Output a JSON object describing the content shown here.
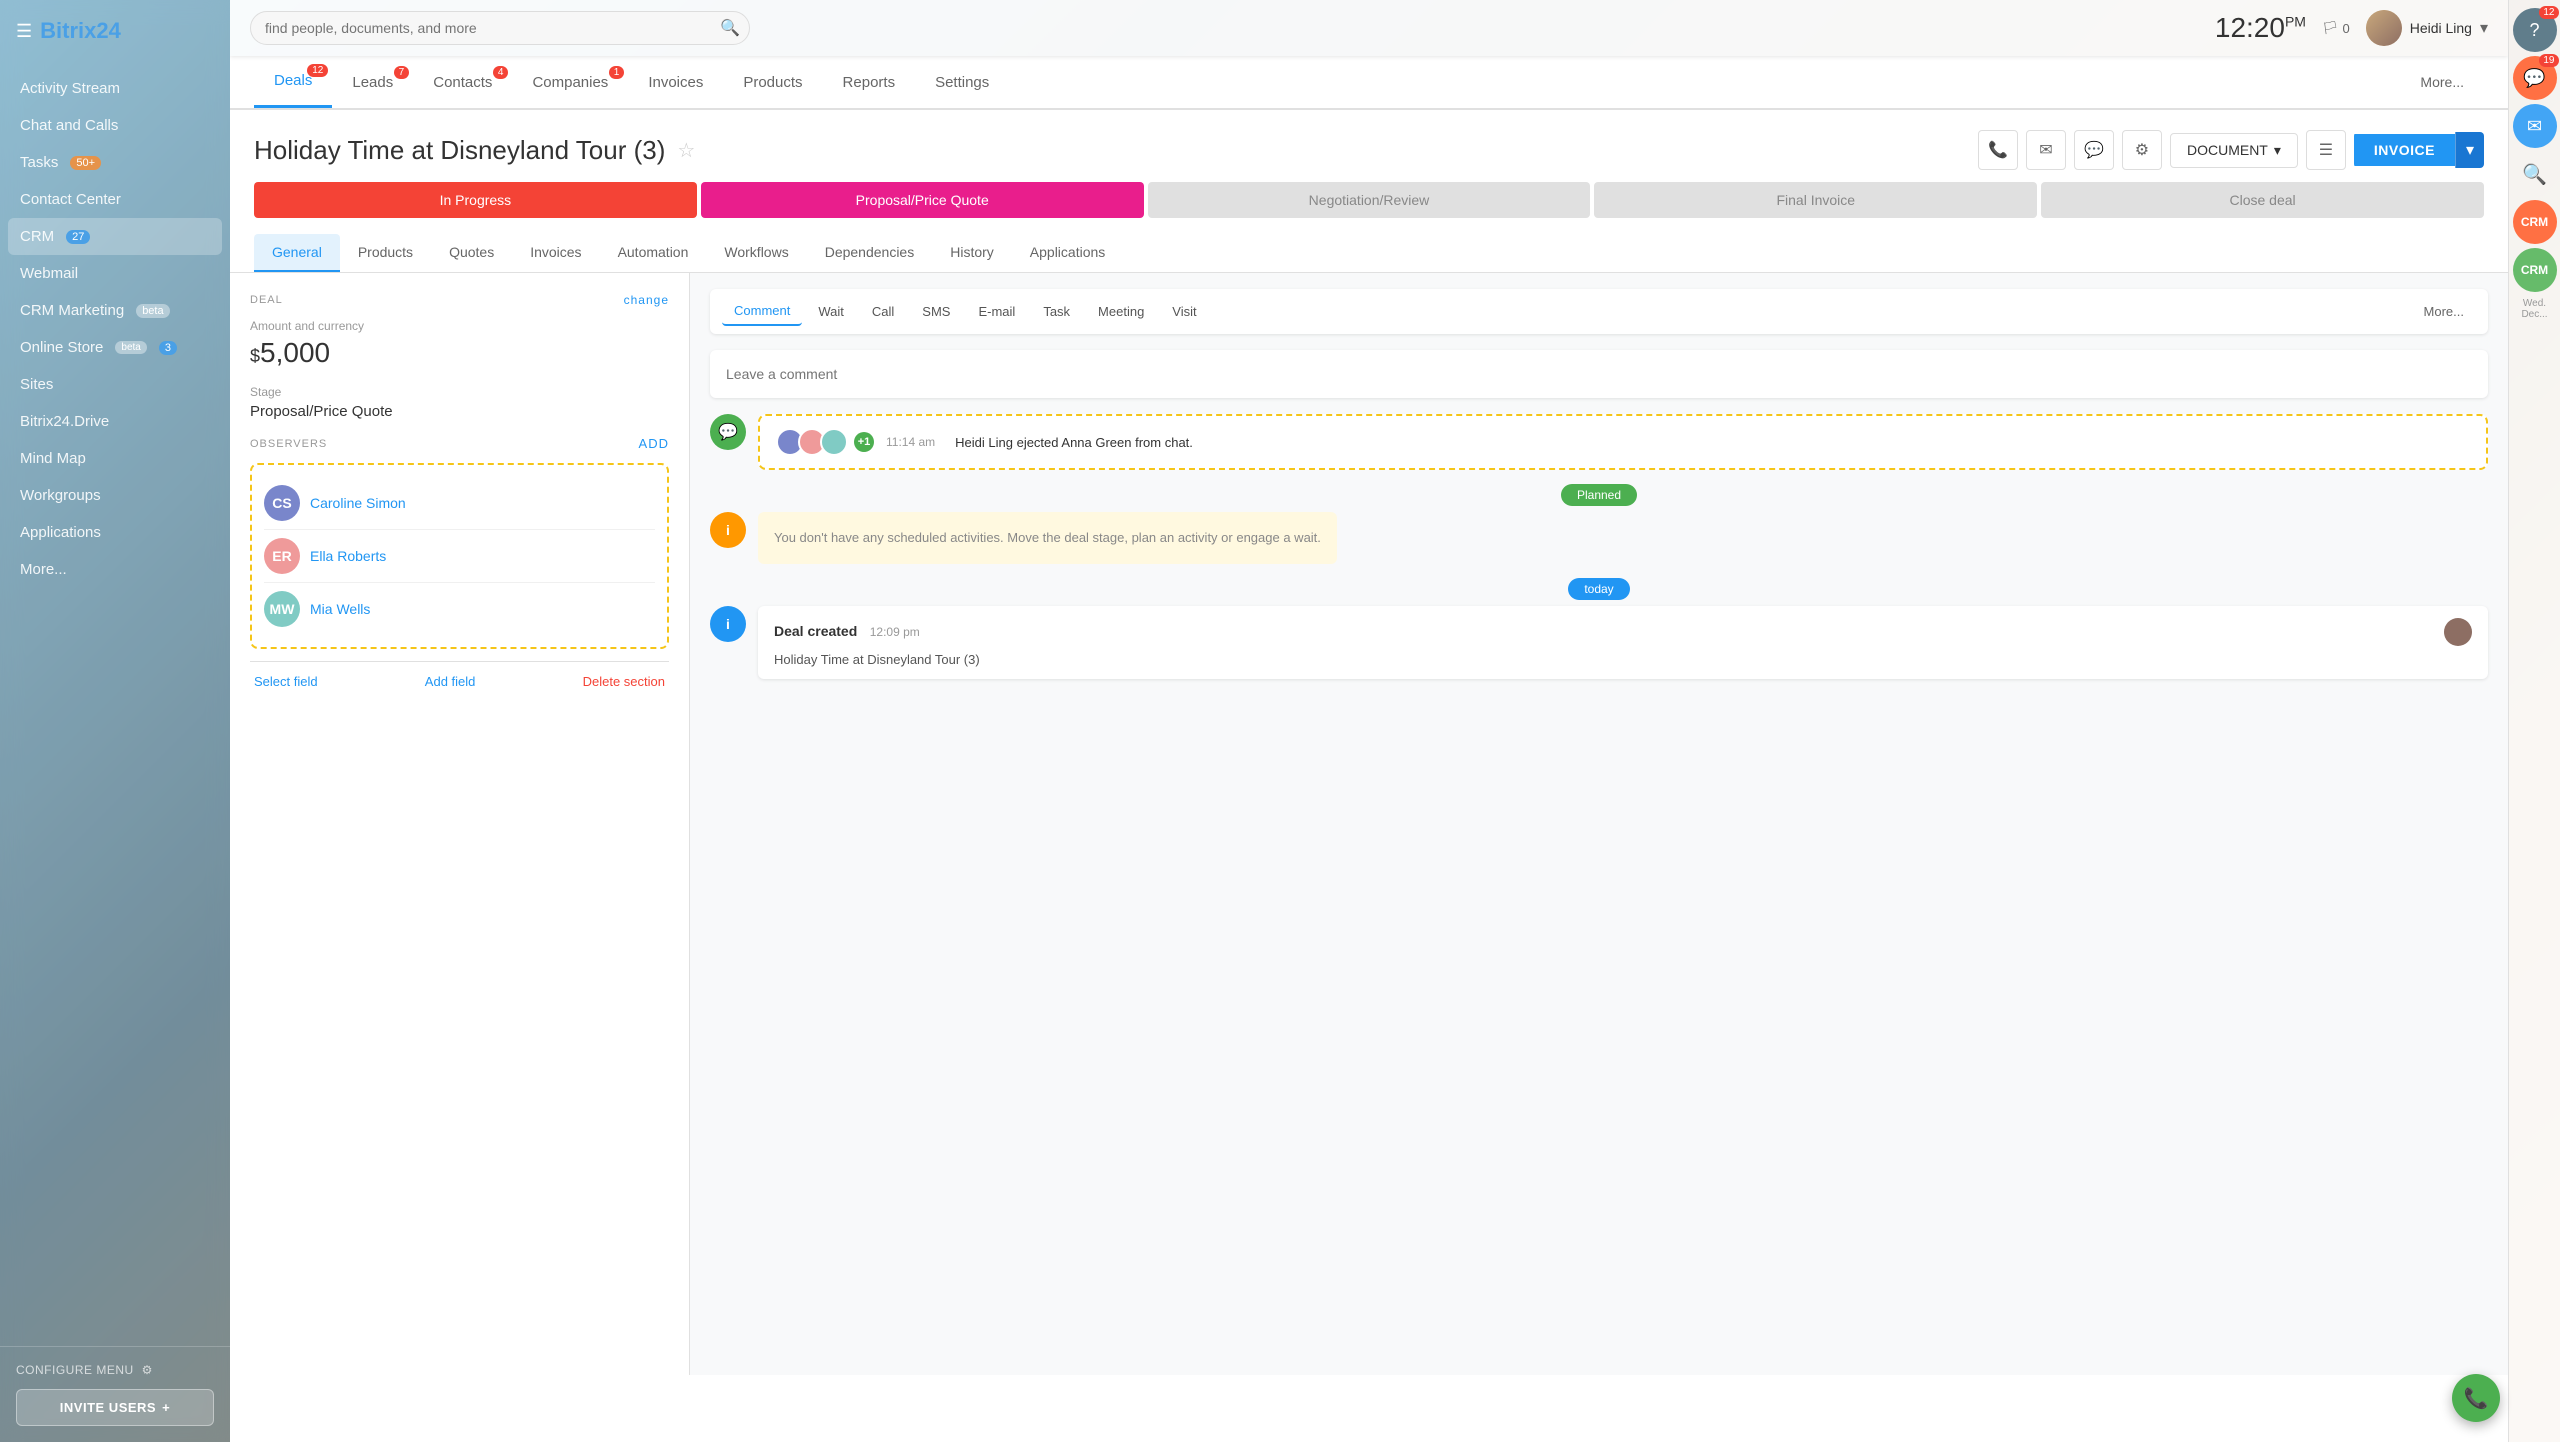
{
  "app": {
    "logo_text_main": "Bitrix",
    "logo_text_accent": "24"
  },
  "topbar": {
    "search_placeholder": "find people, documents, and more",
    "time": "12:20",
    "time_suffix": "PM",
    "flag_count": "0",
    "username": "Heidi Ling"
  },
  "sidebar": {
    "items": [
      {
        "label": "Activity Stream",
        "badge": null
      },
      {
        "label": "Chat and Calls",
        "badge": null
      },
      {
        "label": "Tasks",
        "badge": "50+",
        "badge_type": "orange"
      },
      {
        "label": "Contact Center",
        "badge": null
      },
      {
        "label": "CRM",
        "badge": "27",
        "active": true
      },
      {
        "label": "Webmail",
        "badge": null
      },
      {
        "label": "CRM Marketing",
        "badge": "beta"
      },
      {
        "label": "Online Store",
        "badge": "3",
        "badge_extra": "beta"
      },
      {
        "label": "Sites",
        "badge": null
      },
      {
        "label": "Bitrix24.Drive",
        "badge": null
      },
      {
        "label": "Mind Map",
        "badge": null
      },
      {
        "label": "Workgroups",
        "badge": null
      },
      {
        "label": "Applications",
        "badge": null
      },
      {
        "label": "More...",
        "badge": null
      }
    ],
    "configure_menu": "CONFIGURE MENU",
    "invite_users": "INVITE USERS"
  },
  "crm_tabs": [
    {
      "label": "Deals",
      "badge": "12",
      "active": true
    },
    {
      "label": "Leads",
      "badge": "7"
    },
    {
      "label": "Contacts",
      "badge": "4"
    },
    {
      "label": "Companies",
      "badge": "1"
    },
    {
      "label": "Invoices",
      "badge": null
    },
    {
      "label": "Products",
      "badge": null
    },
    {
      "label": "Reports",
      "badge": null
    },
    {
      "label": "Settings",
      "badge": null
    },
    {
      "label": "More...",
      "badge": null
    }
  ],
  "deal": {
    "title": "Holiday Time at Disneyland Tour (3)",
    "star": "☆",
    "buttons": {
      "phone": "📞",
      "email": "✉",
      "chat": "💬",
      "settings": "⚙",
      "document": "DOCUMENT",
      "invoice": "INVOICE"
    },
    "pipeline": [
      {
        "label": "In Progress",
        "type": "active-red"
      },
      {
        "label": "Proposal/Price Quote",
        "type": "active-pink"
      },
      {
        "label": "Negotiation/Review",
        "type": "inactive"
      },
      {
        "label": "Final Invoice",
        "type": "inactive"
      },
      {
        "label": "Close deal",
        "type": "inactive"
      }
    ],
    "sub_tabs": [
      {
        "label": "General",
        "active": true
      },
      {
        "label": "Products"
      },
      {
        "label": "Quotes"
      },
      {
        "label": "Invoices"
      },
      {
        "label": "Automation"
      },
      {
        "label": "Workflows"
      },
      {
        "label": "Dependencies"
      },
      {
        "label": "History"
      },
      {
        "label": "Applications"
      }
    ]
  },
  "left_panel": {
    "section_title": "DEAL",
    "change_label": "change",
    "amount_label": "Amount and currency",
    "amount_symbol": "$",
    "amount_value": "5,000",
    "stage_label": "Stage",
    "stage_value": "Proposal/Price Quote",
    "observers_label": "Observers",
    "add_label": "add",
    "observers": [
      {
        "name": "Caroline Simon",
        "initials": "CS",
        "color": "#7986cb"
      },
      {
        "name": "Ella Roberts",
        "initials": "ER",
        "color": "#ef9a9a"
      },
      {
        "name": "Mia Wells",
        "initials": "MW",
        "color": "#80cbc4"
      }
    ],
    "select_field": "Select field",
    "add_field": "Add field",
    "delete_section": "Delete section"
  },
  "activity": {
    "tabs": [
      {
        "label": "Comment",
        "active": true
      },
      {
        "label": "Wait"
      },
      {
        "label": "Call"
      },
      {
        "label": "SMS"
      },
      {
        "label": "E-mail"
      },
      {
        "label": "Task"
      },
      {
        "label": "Meeting"
      },
      {
        "label": "Visit"
      },
      {
        "label": "More..."
      }
    ],
    "comment_placeholder": "Leave a comment",
    "chat_time": "11:14 am",
    "chat_text": "Heidi Ling ejected Anna Green from chat.",
    "chat_plus": "+1",
    "planned_label": "Planned",
    "no_activity_text": "You don't have any scheduled activities. Move the deal stage, plan an activity or engage a wait.",
    "today_label": "today",
    "deal_created_title": "Deal created",
    "deal_created_time": "12:09 pm",
    "deal_created_desc": "Holiday Time at Disneyland Tour (3)"
  },
  "right_sidebar": {
    "help_badge": "12",
    "chat_badge": "19",
    "msg_badge": null,
    "date_label": "Wed. Dec..."
  }
}
